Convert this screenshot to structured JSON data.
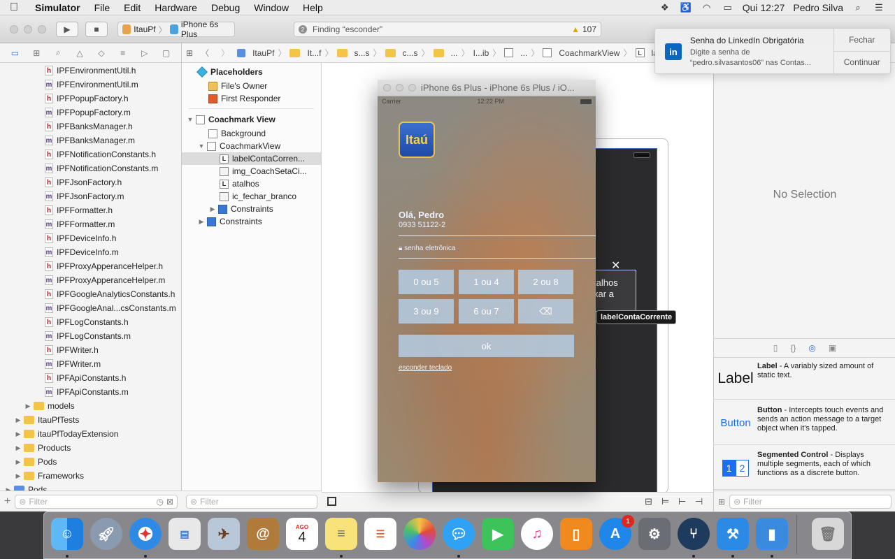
{
  "menubar": {
    "app_name": "Simulator",
    "items": [
      "File",
      "Edit",
      "Hardware",
      "Debug",
      "Window",
      "Help"
    ],
    "clock": "Qui 12:27",
    "user": "Pedro Silva"
  },
  "toolbar": {
    "scheme_project": "ItauPf",
    "scheme_device": "iPhone 6s Plus",
    "activity_text": "Finding “esconder”",
    "activity_count": "2",
    "warnings": "107"
  },
  "jumpbar": {
    "crumbs": [
      "ItauPf",
      "It...f",
      "s...s",
      "c...s",
      "...",
      "I...ib",
      "...",
      "CoachmarkView",
      "labelContaCorre"
    ]
  },
  "navigator": {
    "files": [
      {
        "name": "IPFEnvironmentUtil.h",
        "type": "h"
      },
      {
        "name": "IPFEnvironmentUtil.m",
        "type": "m"
      },
      {
        "name": "IPFPopupFactory.h",
        "type": "h"
      },
      {
        "name": "IPFPopupFactory.m",
        "type": "m"
      },
      {
        "name": "IPFBanksManager.h",
        "type": "h"
      },
      {
        "name": "IPFBanksManager.m",
        "type": "m"
      },
      {
        "name": "IPFNotificationConstants.h",
        "type": "h"
      },
      {
        "name": "IPFNotificationConstants.m",
        "type": "m"
      },
      {
        "name": "IPFJsonFactory.h",
        "type": "h"
      },
      {
        "name": "IPFJsonFactory.m",
        "type": "m"
      },
      {
        "name": "IPFFormatter.h",
        "type": "h"
      },
      {
        "name": "IPFFormatter.m",
        "type": "m"
      },
      {
        "name": "IPFDeviceInfo.h",
        "type": "h"
      },
      {
        "name": "IPFDeviceInfo.m",
        "type": "m"
      },
      {
        "name": "IPFProxyApperanceHelper.h",
        "type": "h"
      },
      {
        "name": "IPFProxyApperanceHelper.m",
        "type": "m"
      },
      {
        "name": "IPFGoogleAnalyticsConstants.h",
        "type": "h"
      },
      {
        "name": "IPFGoogleAnal...csConstants.m",
        "type": "m"
      },
      {
        "name": "IPFLogConstants.h",
        "type": "h"
      },
      {
        "name": "IPFLogConstants.m",
        "type": "m"
      },
      {
        "name": "IPFWriter.h",
        "type": "h"
      },
      {
        "name": "IPFWriter.m",
        "type": "m"
      },
      {
        "name": "IPFApiConstants.h",
        "type": "h"
      },
      {
        "name": "IPFApiConstants.m",
        "type": "m"
      }
    ],
    "groups": [
      {
        "name": "models",
        "indent": 1
      },
      {
        "name": "ItauPfTests",
        "indent": 0
      },
      {
        "name": "itauPfTodayExtension",
        "indent": 0
      },
      {
        "name": "Products",
        "indent": 0
      },
      {
        "name": "Pods",
        "indent": 0
      },
      {
        "name": "Frameworks",
        "indent": 0
      },
      {
        "name": "Pods",
        "indent": -1
      }
    ],
    "filter_placeholder": "Filter"
  },
  "outline": {
    "placeholders_title": "Placeholders",
    "files_owner": "File's Owner",
    "first_responder": "First Responder",
    "view_title": "Coachmark View",
    "background": "Background",
    "coachmark_view": "CoachmarkView",
    "label_conta": "labelContaCorren...",
    "img_coach": "img_CoachSetaCi...",
    "atalhos": "atalhos",
    "ic_fechar": "ic_fechar_branco",
    "constraints_inner": "Constraints",
    "constraints_outer": "Constraints",
    "filter_placeholder": "Filter"
  },
  "simulator": {
    "window_title": "iPhone 6s Plus - iPhone 6s Plus / iO...",
    "carrier": "Carrier",
    "time": "12:22 PM",
    "logo_text": "Itaú",
    "greeting": "Olá, Pedro",
    "account": "0933   51122-2",
    "password_hint": "senha eletrônica",
    "keys": [
      "0 ou 5",
      "1 ou 4",
      "2 ou 8",
      "3 ou 9",
      "6 ou 7",
      "⌫"
    ],
    "ok_label": "ok",
    "hide_keyboard": "esconder teclado"
  },
  "ib": {
    "label_text_line1": "talhos",
    "label_text_line2": "xar a",
    "tooltip": "labelContaCorrente",
    "close_glyph": "✕"
  },
  "notification": {
    "title": "Senha do LinkedIn Obrigatória",
    "line1": "Digite a senha de",
    "line2": "“pedro.silvasantos06” nas Contas...",
    "close_label": "Fechar",
    "continue_label": "Continuar",
    "icon_text": "in"
  },
  "utilities": {
    "no_selection": "No Selection",
    "library": [
      {
        "visual": "Label",
        "title": "Label",
        "desc": " - A variably sized amount of static text."
      },
      {
        "visual": "Button",
        "title": "Button",
        "desc": " - Intercepts touch events and sends an action message to a target object when it's tapped."
      },
      {
        "visual": "segmented",
        "title": "Segmented Control",
        "desc": " - Displays multiple segments, each of which functions as a discrete button."
      }
    ],
    "segment_labels": [
      "1",
      "2"
    ],
    "filter_placeholder": "Filter"
  },
  "dock": {
    "calendar_month": "AGO",
    "calendar_day": "4",
    "appstore_badge": "1",
    "apps": [
      "Finder",
      "Launchpad",
      "Safari",
      "Photos Preview",
      "Preview",
      "Contacts",
      "Calendar",
      "Notes",
      "Reminders",
      "Photos",
      "Messages",
      "FaceTime",
      "iTunes",
      "iBooks",
      "App Store",
      "System Preferences",
      "Sourcetree",
      "Xcode",
      "Simulator",
      "Trash"
    ]
  },
  "colors": {
    "accent": "#1e6cf0",
    "itau_blue": "#1e4ba6",
    "itau_yellow": "#f5d24a",
    "linkedin": "#0b66c2",
    "warning": "#e3a600"
  }
}
